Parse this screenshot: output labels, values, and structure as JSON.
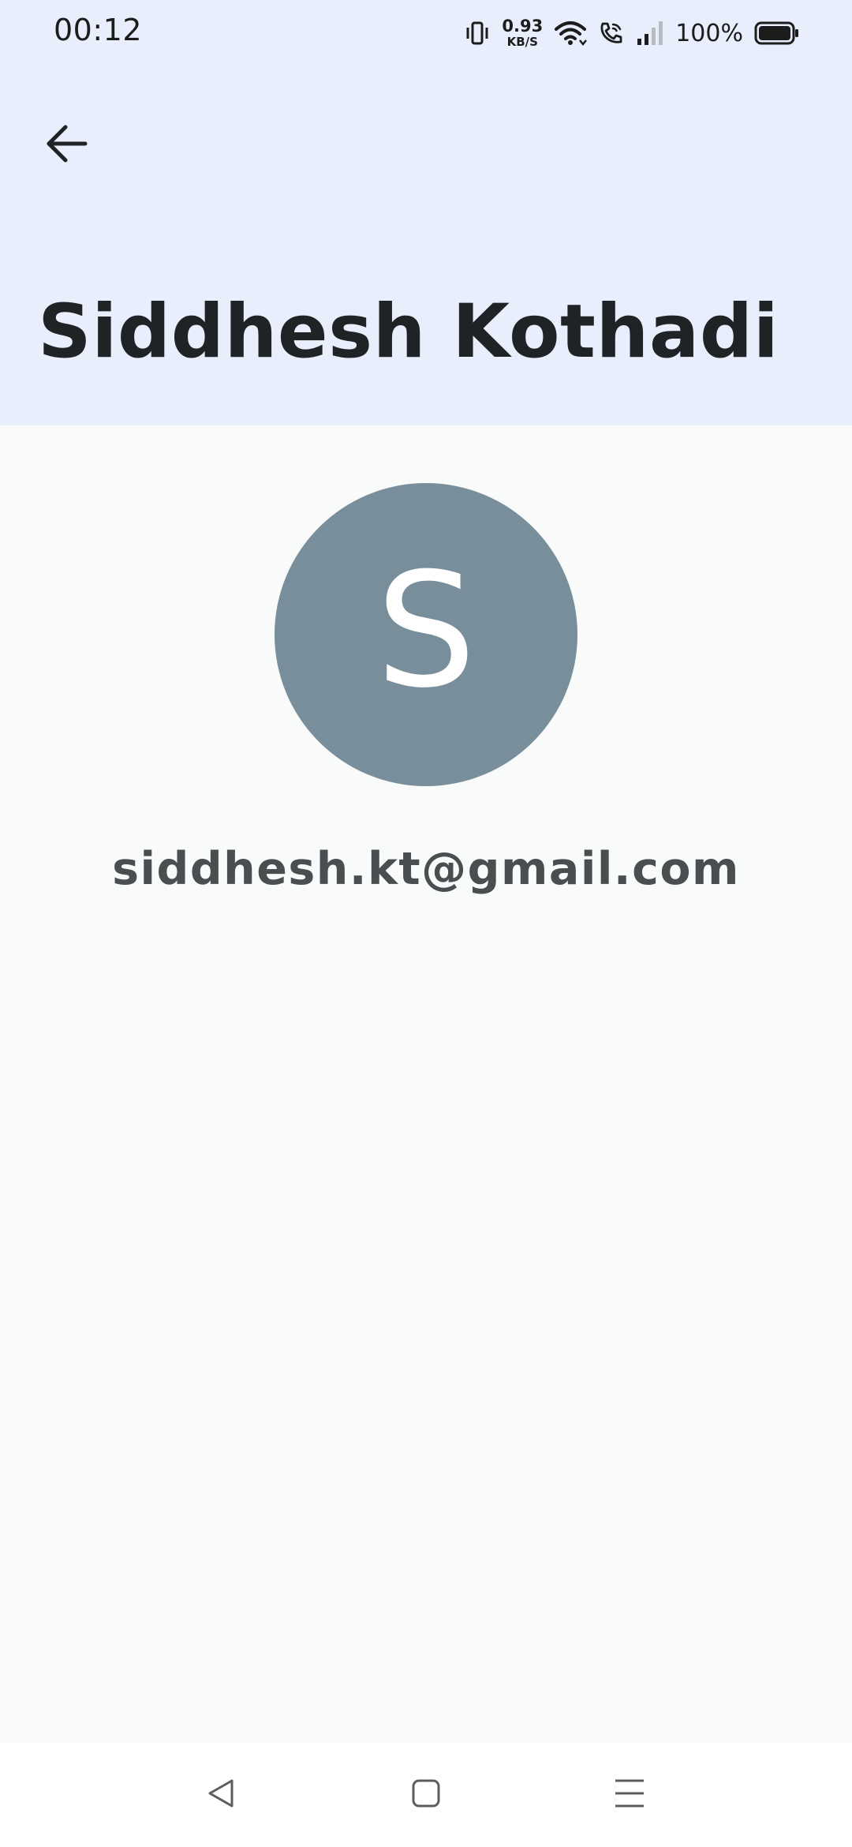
{
  "status_bar": {
    "time": "00:12",
    "net_speed_value": "0.93",
    "net_speed_unit": "KB/S",
    "battery_percent": "100%",
    "icons": [
      "vibrate-icon",
      "wifi-icon",
      "wifi-calling-icon",
      "cellular-signal-icon",
      "battery-icon"
    ]
  },
  "header": {
    "title": "Siddhesh Kothadi",
    "background_color": "#e8eefc",
    "back_icon": "arrow-left-icon"
  },
  "profile": {
    "avatar_letter": "S",
    "avatar_color": "#788f9b",
    "email": "siddhesh.kt@gmail.com"
  },
  "nav_bar": {
    "buttons": [
      "back-triangle-icon",
      "home-square-icon",
      "menu-lines-icon"
    ]
  }
}
